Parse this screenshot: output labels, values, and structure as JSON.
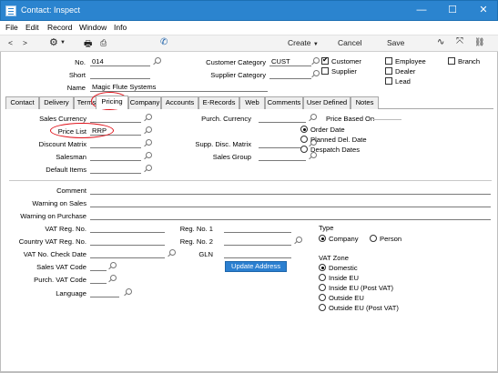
{
  "window": {
    "title": "Contact: Inspect",
    "min": "—",
    "max": "☐",
    "close": "✕"
  },
  "menu": [
    "File",
    "Edit",
    "Record",
    "Window",
    "Info"
  ],
  "toolbar": {
    "create": "Create",
    "cancel": "Cancel",
    "save": "Save"
  },
  "header": {
    "no_label": "No.",
    "no_value": "014",
    "short_label": "Short",
    "short_value": "",
    "name_label": "Name",
    "name_value": "Magic Flute Systems",
    "cust_cat_label": "Customer Category",
    "cust_cat_value": "CUST",
    "supp_cat_label": "Supplier Category",
    "supp_cat_value": "",
    "customer": "Customer",
    "customer_checked": true,
    "supplier": "Supplier",
    "supplier_checked": false,
    "employee": "Employee",
    "dealer": "Dealer",
    "lead": "Lead",
    "branch": "Branch"
  },
  "tabs": [
    "Contact",
    "Delivery",
    "Terms",
    "Pricing",
    "Company",
    "Accounts",
    "E-Records",
    "Web",
    "Comments",
    "User Defined",
    "Notes"
  ],
  "active_tab": "Pricing",
  "pricing": {
    "sales_currency": "Sales Currency",
    "price_list": "Price List",
    "price_list_value": "RRP",
    "discount_matrix": "Discount Matrix",
    "salesman": "Salesman",
    "default_items": "Default Items",
    "purch_currency": "Purch. Currency",
    "supp_disc_matrix": "Supp. Disc. Matrix",
    "sales_group": "Sales Group",
    "price_based_on": "Price Based On",
    "pb_options": [
      "Order Date",
      "Planned Del. Date",
      "Despatch Dates"
    ],
    "pb_selected": 0
  },
  "misc": {
    "comment": "Comment",
    "warning_sales": "Warning on Sales",
    "warning_purchase": "Warning on Purchase",
    "vat_reg": "VAT Reg. No.",
    "country_vat_reg": "Country VAT Reg. No.",
    "vat_check_date": "VAT No. Check Date",
    "sales_vat_code": "Sales VAT Code",
    "purch_vat_code": "Purch. VAT Code",
    "language": "Language",
    "reg1": "Reg. No. 1",
    "reg2": "Reg. No. 2",
    "gln": "GLN",
    "update_address": "Update Address",
    "type": "Type",
    "type_company": "Company",
    "type_person": "Person",
    "vat_zone": "VAT Zone",
    "vat_zone_options": [
      "Domestic",
      "Inside EU",
      "Inside EU (Post VAT)",
      "Outside EU",
      "Outside EU (Post VAT)"
    ],
    "vat_zone_selected": 0
  },
  "colors": {
    "titlebar": "#2b84cf",
    "highlight": "#e0141c",
    "button": "#2b7fd0"
  }
}
